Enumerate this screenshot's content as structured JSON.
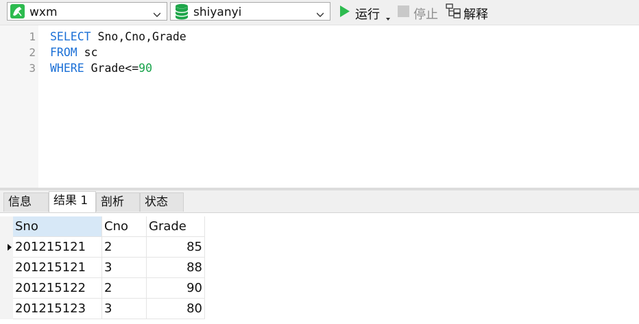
{
  "toolbar": {
    "connection": "wxm",
    "database": "shiyanyi",
    "run_label": "运行",
    "stop_label": "停止",
    "explain_label": "解释",
    "icons": {
      "connection": "mysql-dolphin-icon",
      "database": "database-stack-icon",
      "run": "play-icon",
      "stop": "stop-square-icon",
      "explain": "explain-tree-icon"
    },
    "colors": {
      "connection_icon": "#2dbb4f",
      "run": "#2dbb4f",
      "database": "#1ea64a"
    }
  },
  "editor": {
    "lines": [
      {
        "no": "1",
        "tokens": [
          {
            "t": "SELECT",
            "c": "kw"
          },
          {
            "t": " Sno,Cno,Grade",
            "c": ""
          }
        ]
      },
      {
        "no": "2",
        "tokens": [
          {
            "t": "FROM",
            "c": "kw"
          },
          {
            "t": " sc",
            "c": ""
          }
        ]
      },
      {
        "no": "3",
        "tokens": [
          {
            "t": "WHERE",
            "c": "kw"
          },
          {
            "t": " Grade<=",
            "c": ""
          },
          {
            "t": "90",
            "c": "num"
          }
        ]
      }
    ],
    "colors": {
      "keyword": "#1a6fd6",
      "number": "#17a34a"
    }
  },
  "tabs": [
    {
      "label": "信息",
      "active": false
    },
    {
      "label": "结果 1",
      "active": true
    },
    {
      "label": "剖析",
      "active": false
    },
    {
      "label": "状态",
      "active": false
    }
  ],
  "result": {
    "columns": [
      "Sno",
      "Cno",
      "Grade"
    ],
    "rows": [
      [
        "201215121",
        "2",
        "85"
      ],
      [
        "201215121",
        "3",
        "88"
      ],
      [
        "201215122",
        "2",
        "90"
      ],
      [
        "201215123",
        "3",
        "80"
      ]
    ],
    "current_row": 0,
    "selected_column": 0
  }
}
